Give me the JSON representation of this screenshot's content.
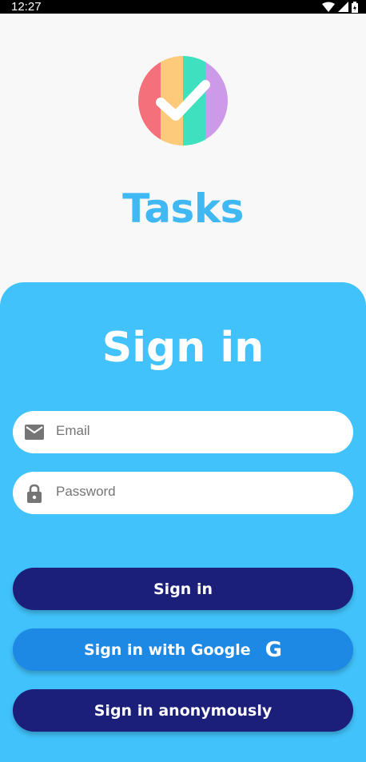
{
  "status_bar": {
    "time": "12:27",
    "icons": [
      "wifi-icon",
      "signal-icon",
      "battery-charging-icon"
    ]
  },
  "logo": {
    "icon": "checkmark-icon",
    "colors": [
      "#f4707a",
      "#fdc97a",
      "#3fe0c0",
      "#cd9ae9"
    ]
  },
  "app": {
    "title": "Tasks"
  },
  "signin_card": {
    "title": "Sign in",
    "background": "#41c2fb",
    "email": {
      "placeholder": "Email",
      "value": "",
      "icon": "mail-icon"
    },
    "password": {
      "placeholder": "Password",
      "value": "",
      "icon": "lock-icon"
    },
    "buttons": {
      "sign_in": "Sign in",
      "google": "Sign in with Google",
      "google_icon": "G",
      "anonymous": "Sign in anonymously"
    }
  },
  "colors": {
    "title": "#3fb8f3",
    "primary_dark": "#1b1f7a",
    "google_blue": "#1e88e5"
  }
}
